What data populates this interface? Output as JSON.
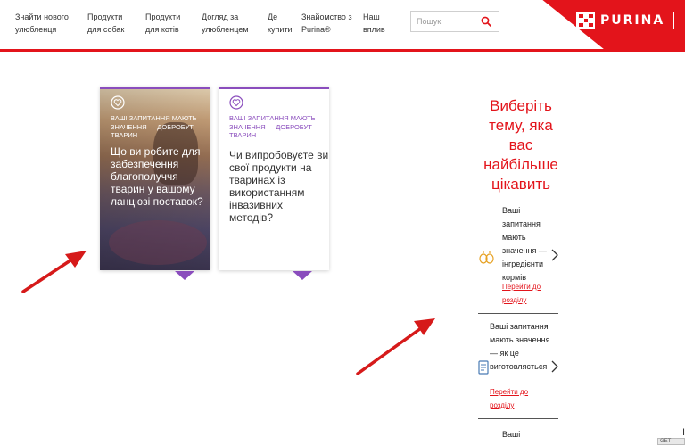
{
  "nav": {
    "items": [
      {
        "line1": "Знайти нового",
        "line2": "улюбленця"
      },
      {
        "line1": "Продукти",
        "line2": "для собак"
      },
      {
        "line1": "Продукти",
        "line2": "для котів"
      },
      {
        "line1": "Догляд за",
        "line2": "улюбленцем"
      },
      {
        "line1": "Де",
        "line2": "купити"
      },
      {
        "line1": "Знайомство з",
        "line2": "Purina®"
      },
      {
        "line1": "Наш",
        "line2": "вплив"
      }
    ]
  },
  "search": {
    "placeholder": "Пошук",
    "icon": "search-icon"
  },
  "logo": {
    "text": "PURINA"
  },
  "colors": {
    "brand_red": "#e3141b",
    "purple": "#8a4dbd"
  },
  "cards": [
    {
      "subtitle": "Ваші запитання мають значення — добробут тварин",
      "title": "Що ви робите для забезпечення благополуччя тварин у вашому ланцюзі поставок?",
      "icon": "heart-badge-icon"
    },
    {
      "subtitle": "Ваші запитання мають значення — добробут тварин",
      "title": "Чи випробовуєте ви свої продукти на тваринах із використанням інвазивних методів?",
      "icon": "heart-badge-icon"
    }
  ],
  "topics": {
    "heading": "Виберіть тему, яка вас найбільше цікавить",
    "items": [
      {
        "text": "Ваші запитання мають значення — інгредієнти кормів",
        "link": "Перейти до розділу",
        "icon": "ingredients-icon"
      },
      {
        "text": "Ваші запитання мають значення — як це виготовляється",
        "link": "Перейти до розділу",
        "icon": "document-icon"
      },
      {
        "text": "Ваші"
      }
    ]
  },
  "corner_label": "GET"
}
